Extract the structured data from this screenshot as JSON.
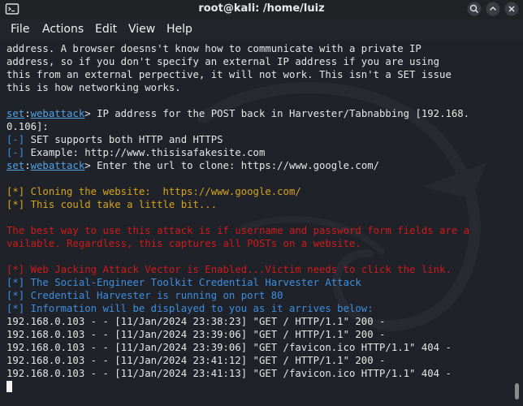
{
  "window": {
    "title": "root@kali: /home/luiz",
    "terminal_icon": "terminal-icon",
    "controls": [
      "search-icon",
      "minimize-icon",
      "maximize-icon",
      "close-icon"
    ]
  },
  "menu": {
    "file": "File",
    "actions": "Actions",
    "edit": "Edit",
    "view": "View",
    "help": "Help"
  },
  "terminal": {
    "l1": "address. A browser doesns't know how to communicate with a private IP",
    "l2": "address, so if you don't specify an external IP address if you are using",
    "l3": "this from an external perpective, it will not work. This isn't a SET issue",
    "l4": "this is how networking works.",
    "p1_set": "set",
    "p1_colon": ":",
    "p1_mod": "webattack",
    "p1_text": "> IP address for the POST back in Harvester/Tabnabbing [192.168.",
    "l6": "0.106]:",
    "l7_tag": "[-]",
    "l7_text": " SET supports both HTTP and HTTPS",
    "l8_tag": "[-]",
    "l8_text": " Example: http://www.thisisafakesite.com",
    "p2_set": "set",
    "p2_colon": ":",
    "p2_mod": "webattack",
    "p2_text": "> Enter the url to clone: https://www.google.com/",
    "l10": "[*] Cloning the website:  https://www.google.com/",
    "l11": "[*] This could take a little bit...",
    "l12": "The best way to use this attack is if username and password form fields are a",
    "l13": "vailable. Regardless, this captures all POSTs on a website.",
    "l14": "[*] Web Jacking Attack Vector is Enabled...Victim needs to click the link.",
    "l15": "[*] The Social-Engineer Toolkit Credential Harvester Attack",
    "l16": "[*] Credential Harvester is running on port 80",
    "l17": "[*] Information will be displayed to you as it arrives below:",
    "log": [
      "192.168.0.103 - - [11/Jan/2024 23:38:23] \"GET / HTTP/1.1\" 200 -",
      "192.168.0.103 - - [11/Jan/2024 23:39:06] \"GET / HTTP/1.1\" 200 -",
      "192.168.0.103 - - [11/Jan/2024 23:39:06] \"GET /favicon.ico HTTP/1.1\" 404 -",
      "192.168.0.103 - - [11/Jan/2024 23:41:12] \"GET / HTTP/1.1\" 200 -",
      "192.168.0.103 - - [11/Jan/2024 23:41:13] \"GET /favicon.ico HTTP/1.1\" 404 -"
    ]
  },
  "colors": {
    "background": "#1f2229",
    "text": "#e6e6e6",
    "set_prompt": "#4fa3e8",
    "info_blue": "#3d8fe0",
    "info_yellow": "#d6a31a",
    "error_red": "#d11a1a"
  }
}
